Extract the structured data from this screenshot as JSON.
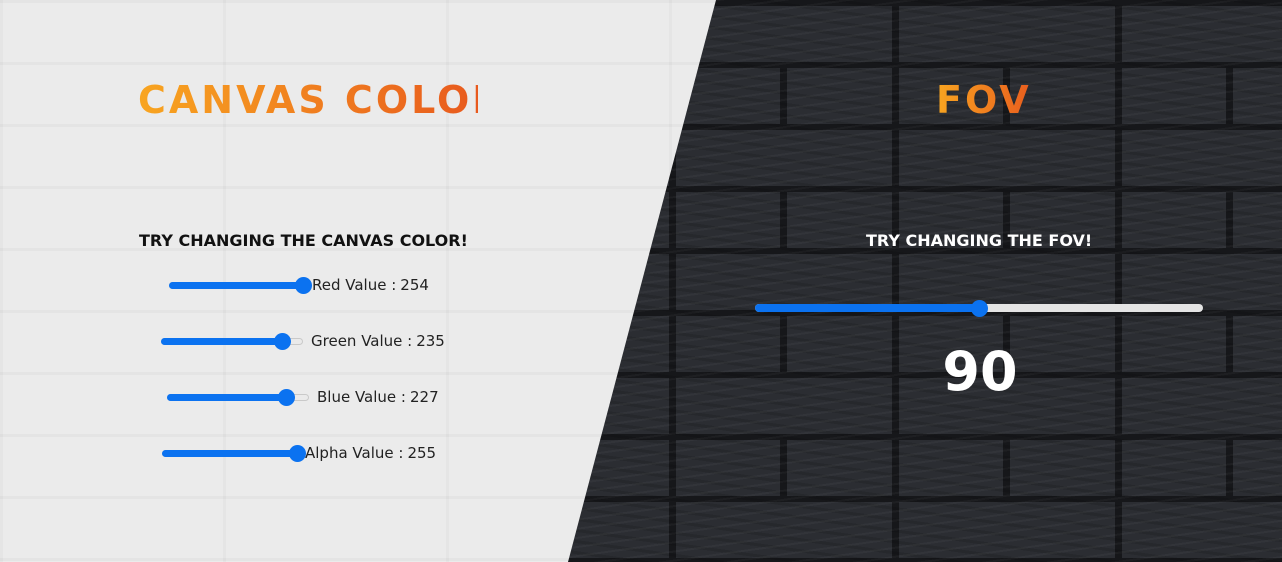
{
  "canvas_panel": {
    "title": "CANVAS COLOR",
    "subtitle": "TRY CHANGING THE CANVAS COLOR!",
    "sliders": [
      {
        "label": "Red Value :",
        "value": "254",
        "fraction": 0.996
      },
      {
        "label": "Green Value :",
        "value": "235",
        "fraction": 0.85
      },
      {
        "label": "Blue Value :",
        "value": "227",
        "fraction": 0.84
      },
      {
        "label": "Alpha Value :",
        "value": "255",
        "fraction": 1.0
      }
    ]
  },
  "fov_panel": {
    "title": "FOV",
    "subtitle": "TRY CHANGING THE FOV!",
    "slider_fraction": 0.5,
    "value": "90"
  },
  "colors": {
    "accent": "#0b72f0",
    "title_gradient_start": "#f8a520",
    "title_gradient_end": "#e85a1e",
    "light_panel": "#ebebeb",
    "brick_dark": "#2b2d32"
  }
}
